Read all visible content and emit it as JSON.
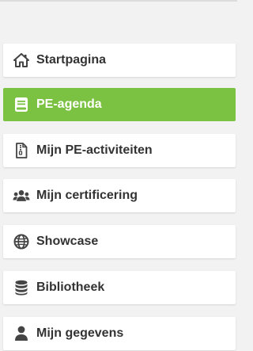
{
  "colors": {
    "active_background": "#7cc242",
    "item_background": "#ffffff",
    "text": "#333333",
    "active_text": "#ffffff",
    "page_background": "#f2f2f2"
  },
  "sidebar": {
    "items": [
      {
        "label": "Startpagina",
        "icon": "home-icon",
        "active": false
      },
      {
        "label": "PE-agenda",
        "icon": "book-icon",
        "active": true
      },
      {
        "label": "Mijn PE-activiteiten",
        "icon": "file-archive-icon",
        "active": false
      },
      {
        "label": "Mijn certificering",
        "icon": "users-icon",
        "active": false
      },
      {
        "label": "Showcase",
        "icon": "globe-icon",
        "active": false
      },
      {
        "label": "Bibliotheek",
        "icon": "database-icon",
        "active": false
      },
      {
        "label": "Mijn gegevens",
        "icon": "user-icon",
        "active": false
      }
    ]
  }
}
